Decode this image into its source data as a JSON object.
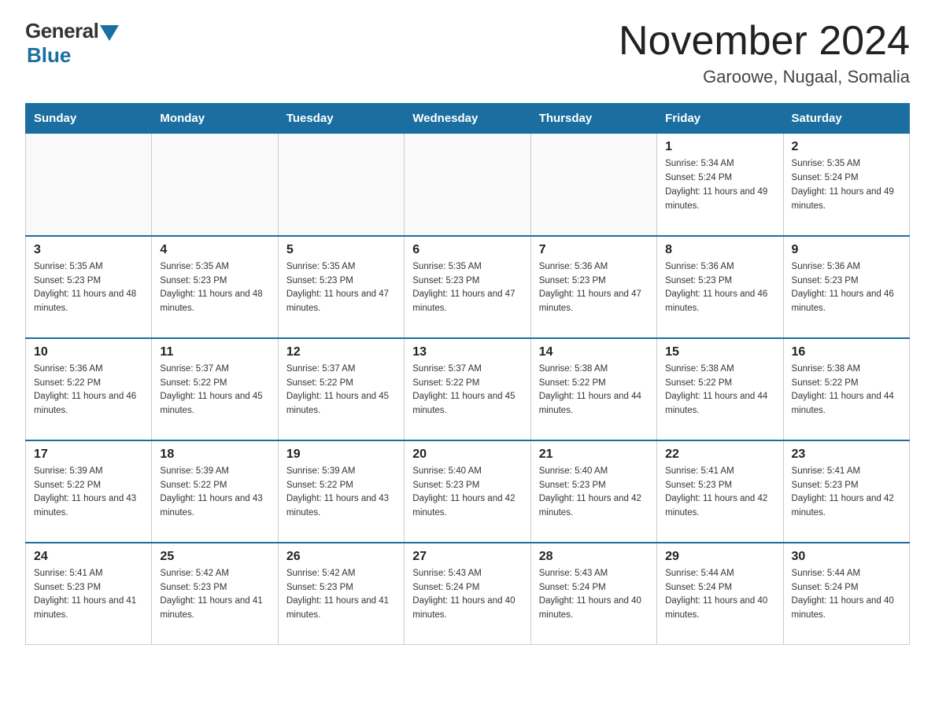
{
  "logo": {
    "general": "General",
    "blue": "Blue"
  },
  "title": "November 2024",
  "subtitle": "Garoowe, Nugaal, Somalia",
  "weekdays": [
    "Sunday",
    "Monday",
    "Tuesday",
    "Wednesday",
    "Thursday",
    "Friday",
    "Saturday"
  ],
  "weeks": [
    [
      {
        "day": "",
        "empty": true
      },
      {
        "day": "",
        "empty": true
      },
      {
        "day": "",
        "empty": true
      },
      {
        "day": "",
        "empty": true
      },
      {
        "day": "",
        "empty": true
      },
      {
        "day": "1",
        "sunrise": "5:34 AM",
        "sunset": "5:24 PM",
        "daylight": "11 hours and 49 minutes."
      },
      {
        "day": "2",
        "sunrise": "5:35 AM",
        "sunset": "5:24 PM",
        "daylight": "11 hours and 49 minutes."
      }
    ],
    [
      {
        "day": "3",
        "sunrise": "5:35 AM",
        "sunset": "5:23 PM",
        "daylight": "11 hours and 48 minutes."
      },
      {
        "day": "4",
        "sunrise": "5:35 AM",
        "sunset": "5:23 PM",
        "daylight": "11 hours and 48 minutes."
      },
      {
        "day": "5",
        "sunrise": "5:35 AM",
        "sunset": "5:23 PM",
        "daylight": "11 hours and 47 minutes."
      },
      {
        "day": "6",
        "sunrise": "5:35 AM",
        "sunset": "5:23 PM",
        "daylight": "11 hours and 47 minutes."
      },
      {
        "day": "7",
        "sunrise": "5:36 AM",
        "sunset": "5:23 PM",
        "daylight": "11 hours and 47 minutes."
      },
      {
        "day": "8",
        "sunrise": "5:36 AM",
        "sunset": "5:23 PM",
        "daylight": "11 hours and 46 minutes."
      },
      {
        "day": "9",
        "sunrise": "5:36 AM",
        "sunset": "5:23 PM",
        "daylight": "11 hours and 46 minutes."
      }
    ],
    [
      {
        "day": "10",
        "sunrise": "5:36 AM",
        "sunset": "5:22 PM",
        "daylight": "11 hours and 46 minutes."
      },
      {
        "day": "11",
        "sunrise": "5:37 AM",
        "sunset": "5:22 PM",
        "daylight": "11 hours and 45 minutes."
      },
      {
        "day": "12",
        "sunrise": "5:37 AM",
        "sunset": "5:22 PM",
        "daylight": "11 hours and 45 minutes."
      },
      {
        "day": "13",
        "sunrise": "5:37 AM",
        "sunset": "5:22 PM",
        "daylight": "11 hours and 45 minutes."
      },
      {
        "day": "14",
        "sunrise": "5:38 AM",
        "sunset": "5:22 PM",
        "daylight": "11 hours and 44 minutes."
      },
      {
        "day": "15",
        "sunrise": "5:38 AM",
        "sunset": "5:22 PM",
        "daylight": "11 hours and 44 minutes."
      },
      {
        "day": "16",
        "sunrise": "5:38 AM",
        "sunset": "5:22 PM",
        "daylight": "11 hours and 44 minutes."
      }
    ],
    [
      {
        "day": "17",
        "sunrise": "5:39 AM",
        "sunset": "5:22 PM",
        "daylight": "11 hours and 43 minutes."
      },
      {
        "day": "18",
        "sunrise": "5:39 AM",
        "sunset": "5:22 PM",
        "daylight": "11 hours and 43 minutes."
      },
      {
        "day": "19",
        "sunrise": "5:39 AM",
        "sunset": "5:22 PM",
        "daylight": "11 hours and 43 minutes."
      },
      {
        "day": "20",
        "sunrise": "5:40 AM",
        "sunset": "5:23 PM",
        "daylight": "11 hours and 42 minutes."
      },
      {
        "day": "21",
        "sunrise": "5:40 AM",
        "sunset": "5:23 PM",
        "daylight": "11 hours and 42 minutes."
      },
      {
        "day": "22",
        "sunrise": "5:41 AM",
        "sunset": "5:23 PM",
        "daylight": "11 hours and 42 minutes."
      },
      {
        "day": "23",
        "sunrise": "5:41 AM",
        "sunset": "5:23 PM",
        "daylight": "11 hours and 42 minutes."
      }
    ],
    [
      {
        "day": "24",
        "sunrise": "5:41 AM",
        "sunset": "5:23 PM",
        "daylight": "11 hours and 41 minutes."
      },
      {
        "day": "25",
        "sunrise": "5:42 AM",
        "sunset": "5:23 PM",
        "daylight": "11 hours and 41 minutes."
      },
      {
        "day": "26",
        "sunrise": "5:42 AM",
        "sunset": "5:23 PM",
        "daylight": "11 hours and 41 minutes."
      },
      {
        "day": "27",
        "sunrise": "5:43 AM",
        "sunset": "5:24 PM",
        "daylight": "11 hours and 40 minutes."
      },
      {
        "day": "28",
        "sunrise": "5:43 AM",
        "sunset": "5:24 PM",
        "daylight": "11 hours and 40 minutes."
      },
      {
        "day": "29",
        "sunrise": "5:44 AM",
        "sunset": "5:24 PM",
        "daylight": "11 hours and 40 minutes."
      },
      {
        "day": "30",
        "sunrise": "5:44 AM",
        "sunset": "5:24 PM",
        "daylight": "11 hours and 40 minutes."
      }
    ]
  ]
}
